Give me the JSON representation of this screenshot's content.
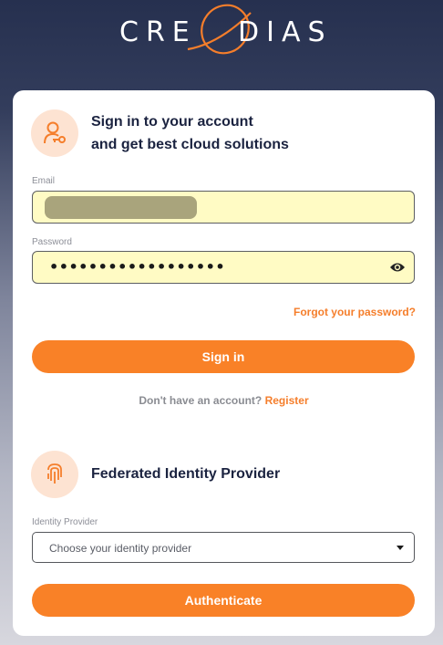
{
  "brand": {
    "name_left": "CRE",
    "name_right": "DIAS",
    "accent_color": "#f57e2b"
  },
  "signin": {
    "icon": "user-key-icon",
    "heading_line1": "Sign in to your account",
    "heading_line2": "and get best cloud solutions",
    "email_label": "Email",
    "email_value": "",
    "password_label": "Password",
    "password_value": "••••••••••••••••••",
    "forgot_label": "Forgot your password?",
    "submit_label": "Sign in",
    "no_account_text": "Don't have an account?",
    "register_label": "Register"
  },
  "federated": {
    "icon": "fingerprint-icon",
    "heading": "Federated Identity Provider",
    "provider_label": "Identity Provider",
    "provider_placeholder": "Choose your identity provider",
    "submit_label": "Authenticate"
  }
}
